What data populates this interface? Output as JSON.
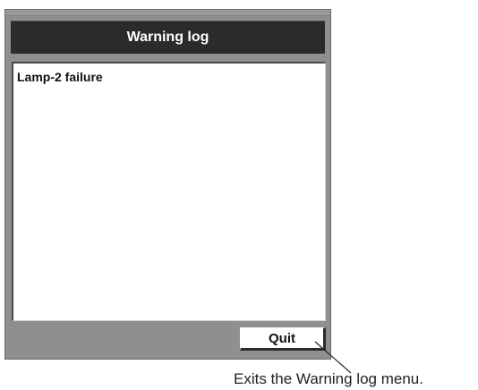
{
  "dialog": {
    "title": "Warning log",
    "entries": [
      "Lamp-2 failure"
    ],
    "quit_label": "Quit"
  },
  "annotation": {
    "caption": "Exits the Warning log menu."
  }
}
